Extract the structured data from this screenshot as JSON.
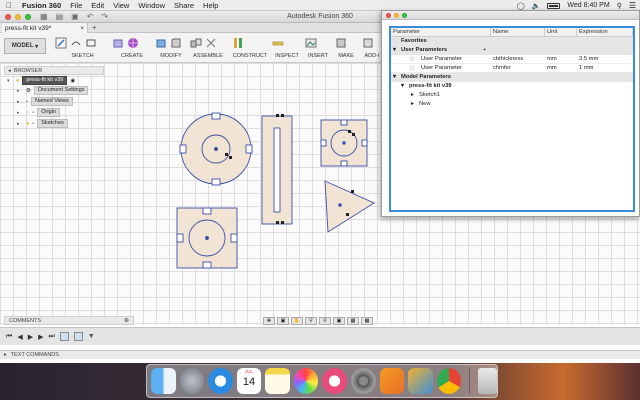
{
  "menubar": {
    "app": "Fusion 360",
    "items": [
      "File",
      "Edit",
      "View",
      "Window",
      "Share",
      "Help"
    ],
    "clock": "Wed 8:40 PM"
  },
  "window": {
    "title": "Autodesk Fusion 360",
    "tab_label": "press-fit kit v39*"
  },
  "toolbar": {
    "workspace": "MODEL",
    "groups": [
      "SKETCH",
      "CREATE",
      "MODIFY",
      "ASSEMBLE",
      "CONSTRUCT",
      "INSPECT",
      "INSERT",
      "MAKE",
      "ADD-I"
    ]
  },
  "browser": {
    "header": "BROWSER",
    "root": "press-fit kit v39",
    "items": [
      "Document Settings",
      "Named Views",
      "Origin",
      "Sketches"
    ]
  },
  "comments": {
    "label": "COMMENTS"
  },
  "textcommands": {
    "label": "TEXT COMMANDS"
  },
  "parameters": {
    "columns": [
      "Parameter",
      "Name",
      "Unit",
      "Expression"
    ],
    "favorites": "Favorites",
    "user_section": "User Parameters",
    "user_params": [
      {
        "parameter": "User Parameter",
        "name": "cbthickness",
        "unit": "mm",
        "expression": "3.5 mm"
      },
      {
        "parameter": "User Parameter",
        "name": "chmfer",
        "unit": "mm",
        "expression": "1 mm"
      }
    ],
    "model_section": "Model Parameters",
    "model_root": "press-fit kit v39",
    "model_children": [
      "Sketch1",
      "New"
    ]
  },
  "dock": {
    "calendar_month": "JUL",
    "calendar_day": "14",
    "icons": [
      "finder-icon",
      "launchpad-icon",
      "safari-icon",
      "calendar-icon",
      "notes-icon",
      "photos-icon",
      "itunes-icon",
      "system-preferences-icon",
      "fusion360-icon",
      "fusion360-alt-icon",
      "chrome-icon",
      "trash-icon"
    ]
  },
  "colors": {
    "sketch_fill": "#f1e4d4",
    "sketch_stroke": "#3c4fa8",
    "selection_blue": "#3b8bd9"
  }
}
